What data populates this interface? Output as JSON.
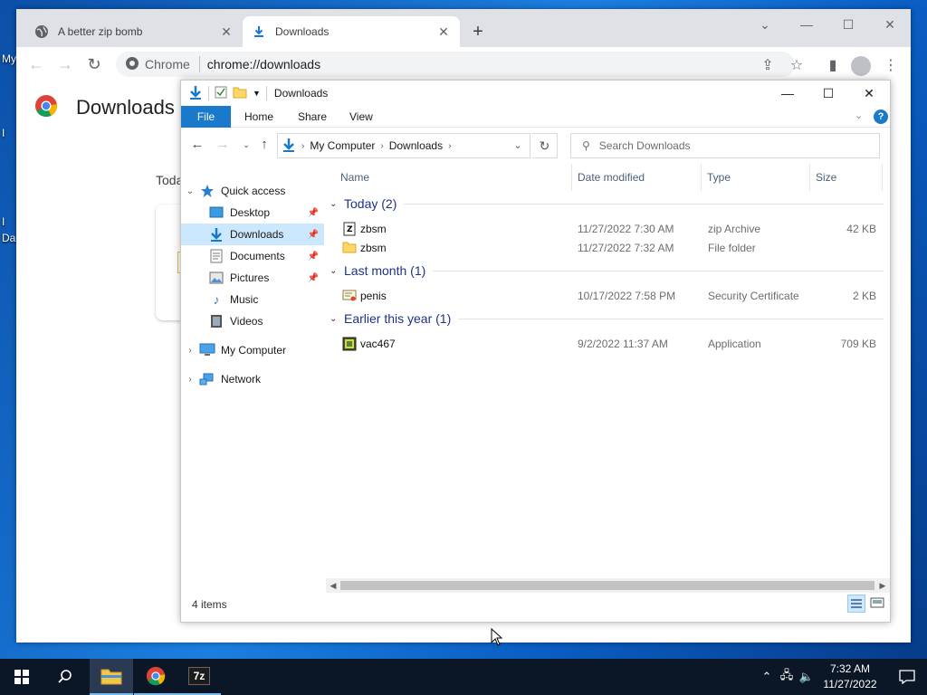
{
  "desktop": {
    "labels": [
      "My",
      "I",
      "I",
      "Da"
    ]
  },
  "chrome": {
    "tabs": [
      {
        "title": "A better zip bomb"
      },
      {
        "title": "Downloads"
      }
    ],
    "new_tab": "+",
    "omnibox": {
      "chip": "Chrome",
      "url": "chrome://downloads"
    },
    "page_title": "Downloads",
    "today_label": "Toda"
  },
  "explorer": {
    "title": "Downloads",
    "ribbon_tabs": [
      "File",
      "Home",
      "Share",
      "View"
    ],
    "breadcrumb": [
      "My Computer",
      "Downloads"
    ],
    "search_placeholder": "Search Downloads",
    "nav": {
      "quick_access": "Quick access",
      "items": [
        "Desktop",
        "Downloads",
        "Documents",
        "Pictures",
        "Music",
        "Videos"
      ],
      "my_computer": "My Computer",
      "network": "Network"
    },
    "columns": [
      "Name",
      "Date modified",
      "Type",
      "Size"
    ],
    "groups": [
      {
        "label": "Today (2)",
        "files": [
          {
            "name": "zbsm",
            "date": "11/27/2022 7:30 AM",
            "type": "zip Archive",
            "size": "42 KB",
            "icon": "zip-archive-icon"
          },
          {
            "name": "zbsm",
            "date": "11/27/2022 7:32 AM",
            "type": "File folder",
            "size": "",
            "icon": "folder-icon"
          }
        ]
      },
      {
        "label": "Last month (1)",
        "files": [
          {
            "name": "penis",
            "date": "10/17/2022 7:58 PM",
            "type": "Security Certificate",
            "size": "2 KB",
            "icon": "certificate-icon"
          }
        ]
      },
      {
        "label": "Earlier this year (1)",
        "files": [
          {
            "name": "vac467",
            "date": "9/2/2022 11:37 AM",
            "type": "Application",
            "size": "709 KB",
            "icon": "application-icon"
          }
        ]
      }
    ],
    "status": "4 items"
  },
  "taskbar": {
    "time": "7:32 AM",
    "date": "11/27/2022",
    "sevenzip_label": "7z"
  },
  "colors": {
    "accent": "#1979ca",
    "selection": "#cce8ff",
    "group_header": "#1e3287",
    "taskbar": "#0b1626"
  }
}
